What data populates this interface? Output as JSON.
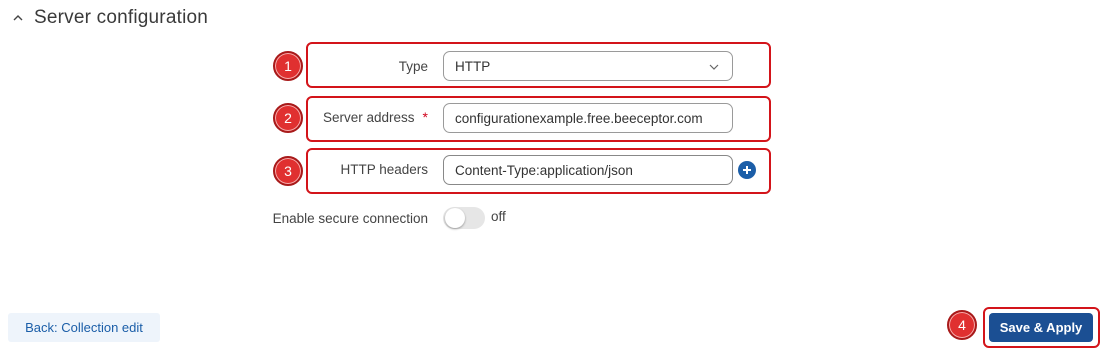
{
  "section": {
    "title": "Server configuration",
    "collapse_icon": "chevron-up-icon"
  },
  "form": {
    "type": {
      "label": "Type",
      "value": "HTTP",
      "dropdown_icon": "chevron-down-icon"
    },
    "server_address": {
      "label": "Server address",
      "required_mark": "*",
      "value": "configurationexample.free.beeceptor.com"
    },
    "http_headers": {
      "label": "HTTP headers",
      "value": "Content-Type:application/json",
      "add_icon": "plus-circle-icon"
    },
    "secure_connection": {
      "label": "Enable secure connection",
      "state_text": "off",
      "enabled": false
    }
  },
  "annotations": {
    "badge1": "1",
    "badge2": "2",
    "badge3": "3",
    "badge4": "4",
    "highlight_color": "#d3141a"
  },
  "footer": {
    "back_label": "Back: Collection edit",
    "save_label": "Save & Apply"
  },
  "colors": {
    "primary": "#1b4f93",
    "accent": "#1b5ea8"
  }
}
